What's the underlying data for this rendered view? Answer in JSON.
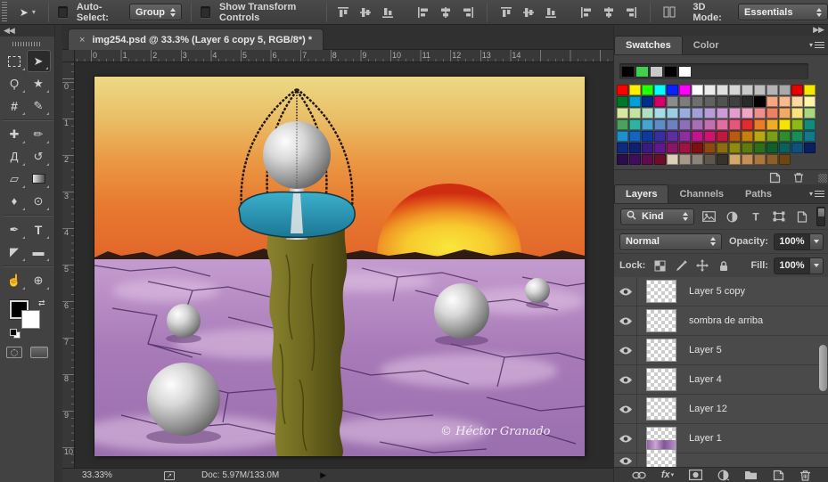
{
  "options_bar": {
    "auto_select_label": "Auto-Select:",
    "auto_select_value": "Group",
    "show_transform_label": "Show Transform Controls",
    "mode_label": "3D Mode:",
    "workspace_value": "Essentials",
    "align_icons": [
      "align-top-edges-icon",
      "align-vertical-centers-icon",
      "align-bottom-edges-icon",
      "align-left-edges-icon",
      "align-horizontal-centers-icon",
      "align-right-edges-icon",
      "distribute-top-edges-icon",
      "distribute-vertical-centers-icon",
      "distribute-bottom-edges-icon",
      "distribute-left-edges-icon",
      "distribute-horizontal-centers-icon",
      "distribute-right-edges-icon",
      "auto-align-layers-icon"
    ]
  },
  "tool_panel": {
    "collapse_glyph": "◀◀",
    "tools": [
      {
        "name": "rectangular-marquee-tool",
        "glyph": ""
      },
      {
        "name": "move-tool",
        "glyph": "➤",
        "active": true
      },
      {
        "name": "lasso-tool",
        "glyph": "Ϙ"
      },
      {
        "name": "magic-wand-tool",
        "glyph": "★"
      },
      {
        "name": "crop-tool",
        "glyph": "#"
      },
      {
        "name": "eyedropper-tool",
        "glyph": "✎"
      },
      {
        "name": "spot-healing-brush-tool",
        "glyph": "✚"
      },
      {
        "name": "brush-tool",
        "glyph": "✏"
      },
      {
        "name": "clone-stamp-tool",
        "glyph": "Д"
      },
      {
        "name": "history-brush-tool",
        "glyph": "↺"
      },
      {
        "name": "eraser-tool",
        "glyph": "▱"
      },
      {
        "name": "gradient-tool",
        "glyph": ""
      },
      {
        "name": "blur-tool",
        "glyph": "♦"
      },
      {
        "name": "dodge-tool",
        "glyph": "⊙"
      },
      {
        "name": "pen-tool",
        "glyph": "✒"
      },
      {
        "name": "type-tool",
        "glyph": "T"
      },
      {
        "name": "path-selection-tool",
        "glyph": "◤"
      },
      {
        "name": "rectangle-tool",
        "glyph": "▬"
      },
      {
        "name": "hand-tool",
        "glyph": "☝"
      },
      {
        "name": "zoom-tool",
        "glyph": "⊕"
      }
    ],
    "group_breaks_after": [
      5,
      13,
      17
    ],
    "foreground_color": "#000000",
    "background_color": "#ffffff"
  },
  "document": {
    "tab_title": "img254.psd @ 33.3% (Layer 6 copy 5, RGB/8*) *",
    "close_glyph": "×",
    "rulers": {
      "horizontal": [
        "0",
        "1",
        "2",
        "3",
        "4",
        "5",
        "6",
        "7",
        "8",
        "9",
        "10",
        "11",
        "12",
        "13",
        "14"
      ],
      "vertical": [
        "0",
        "1",
        "2",
        "3",
        "4",
        "5",
        "6",
        "7",
        "8",
        "9",
        "10"
      ]
    },
    "status": {
      "zoom": "33.33%",
      "doc_sizes": "Doc: 5.97M/133.0M",
      "menu_glyph": "▶"
    },
    "artwork": {
      "signature": "© Héctor Granado",
      "sky_top": "#ecd985",
      "sky_bottom": "#e2662a",
      "sun_core": "#f9e73c",
      "sun_rim": "#cf2d12",
      "ground": "#a87bb8",
      "tower": "#6d671f",
      "pool": "#2188a8",
      "sphere": "#d8d8d8"
    }
  },
  "swatches_panel": {
    "tabs": [
      "Swatches",
      "Color"
    ],
    "active_tab": "Swatches",
    "recent": [
      "#000000",
      "#3fd04f",
      "#c9c9c9",
      "#000000",
      "#ffffff"
    ],
    "grid": [
      [
        "#ff0000",
        "#ffee00",
        "#22ff06",
        "#00ffff",
        "#0923ff",
        "#ff00ff",
        "#ffffff",
        "#ececec",
        "#e0e0e0",
        "#d5d5d5",
        "#cacaca",
        "#bfbfbf",
        "#b4b4b4",
        "#a9a9a9",
        "#e80000",
        "#f6e700"
      ],
      [
        "#00782a",
        "#00a0d8",
        "#002d8c",
        "#d4006a",
        "#8b8b8b",
        "#7d7d7d",
        "#6f6f6f",
        "#616161",
        "#525252",
        "#404040",
        "#2a2a2a",
        "#000000",
        "#f4a780",
        "#f7b98e",
        "#fbd7a2",
        "#fdf3a9"
      ],
      [
        "#d7e8a0",
        "#c3e4a2",
        "#b2dfc2",
        "#a5dce5",
        "#9ccce6",
        "#9badde",
        "#a49ed8",
        "#b79dd8",
        "#cb9bd8",
        "#e59ccd",
        "#f0a5c5",
        "#ef8e8e",
        "#ee8064",
        "#f2a963",
        "#f6e37d",
        "#aad67f"
      ],
      [
        "#49a35f",
        "#2eb3a3",
        "#49a3d2",
        "#5f8cc7",
        "#6f7fc0",
        "#8c6fb7",
        "#a86fb2",
        "#c26fae",
        "#e06e9e",
        "#e8547a",
        "#e02c2c",
        "#e87c28",
        "#eead28",
        "#f4e400",
        "#8cb818",
        "#128c7a"
      ],
      [
        "#1e90d0",
        "#1565c0",
        "#0d3a9e",
        "#3a2da0",
        "#5e2d9e",
        "#8c2da0",
        "#c2158c",
        "#cf1470",
        "#c21840",
        "#b85a10",
        "#c77f10",
        "#b8a812",
        "#7a9e18",
        "#2e8c2e",
        "#188c5a",
        "#0f7a8c"
      ],
      [
        "#0d2a7e",
        "#101f6e",
        "#3a1a7e",
        "#5e1a8c",
        "#8c1464",
        "#9e1440",
        "#7e1010",
        "#8c4a10",
        "#8c6e10",
        "#8c8c10",
        "#5e7a10",
        "#2e6e1f",
        "#10602e",
        "#0f5e5e",
        "#10507e",
        "#0a1f5e"
      ],
      [
        "#2a0d4a",
        "#3f0d5e",
        "#5e0d4a",
        "#6e0d2a",
        "#ddd0b8",
        "#a89888",
        "#8c8478",
        "#5e564a",
        "#38332a",
        "#d4a868",
        "#c49058",
        "#a87840",
        "#8c5e2a",
        "#6e4514"
      ]
    ]
  },
  "layers_panel": {
    "tabs": [
      "Layers",
      "Channels",
      "Paths"
    ],
    "active_tab": "Layers",
    "kind_value": "Kind",
    "filter_icons": [
      "pixel-layer-filter-icon",
      "adjustment-layer-filter-icon",
      "type-layer-filter-icon",
      "shape-layer-filter-icon",
      "smart-object-filter-icon"
    ],
    "blend_mode_value": "Normal",
    "opacity_label": "Opacity:",
    "opacity_value": "100%",
    "lock_label": "Lock:",
    "lock_icons": [
      "lock-transparency-icon",
      "lock-paint-icon",
      "lock-position-icon",
      "lock-all-icon"
    ],
    "fill_label": "Fill:",
    "fill_value": "100%",
    "layers": [
      {
        "name": "Layer 5 copy",
        "visible": true
      },
      {
        "name": "sombra de arriba",
        "visible": true
      },
      {
        "name": "Layer 5",
        "visible": true
      },
      {
        "name": "Layer 4",
        "visible": true
      },
      {
        "name": "Layer 12",
        "visible": true
      },
      {
        "name": "Layer 1",
        "visible": true,
        "thumb_has_pixels": true
      },
      {
        "name": "",
        "visible": true,
        "partial": true
      }
    ],
    "footer_icons": [
      "link-layers-icon",
      "fx-icon",
      "layer-mask-icon",
      "adjustment-layer-icon",
      "new-group-icon",
      "new-layer-icon",
      "delete-layer-icon"
    ]
  }
}
